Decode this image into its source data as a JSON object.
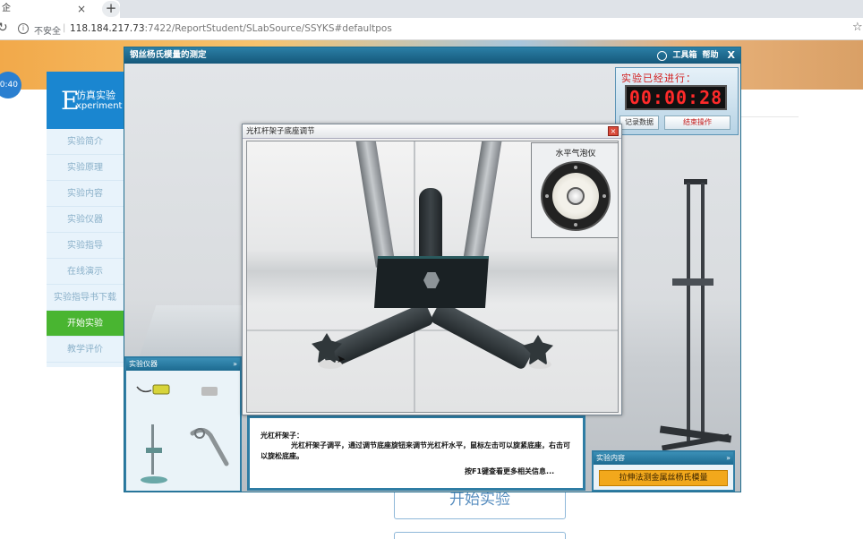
{
  "browser": {
    "tab_title": "企",
    "tab_close": "×",
    "new_tab": "+",
    "reload_icon": "↻",
    "info_icon": "i",
    "security_text": "不安全",
    "separator": "|",
    "url_host": "118.184.217.73",
    "url_rest": ":7422/ReportStudent/SLabSource/SSYKS#defaultpos",
    "bookmark_icon": "☆"
  },
  "page": {
    "clock_badge": "0:40",
    "logo_letter": "E",
    "logo_cn": "仿真实验",
    "logo_en": "xperiment",
    "start_button": "开始实验"
  },
  "sidebar": {
    "items": [
      {
        "label": "实验简介"
      },
      {
        "label": "实验原理"
      },
      {
        "label": "实验内容"
      },
      {
        "label": "实验仪器"
      },
      {
        "label": "实验指导"
      },
      {
        "label": "在线演示"
      },
      {
        "label": "实验指导书下载"
      },
      {
        "label": "开始实验"
      },
      {
        "label": "教学评价"
      }
    ],
    "active_index": 7
  },
  "sim": {
    "title": "钢丝杨氏模量的测定",
    "toolbox_label": "工具箱",
    "help_label": "帮助",
    "close_label": "X",
    "timer": {
      "label": "实验已经进行：",
      "value": "00:00:28",
      "record_button": "记录数据",
      "end_button": "结束操作"
    },
    "equipment_panel": {
      "title": "实验仪器",
      "collapse_icon": "»"
    },
    "content_panel": {
      "title": "实验内容",
      "collapse_icon": "»",
      "item": "拉伸法测金属丝杨氏模量"
    },
    "info": {
      "heading": "光杠杆架子：",
      "body": "光杠杆架子调平，通过调节底座旋钮来调节光杠杆水平，鼠标左击可以旋紧底座，右击可以旋松底座。",
      "hint": "按F1键查看更多相关信息..."
    }
  },
  "dialog": {
    "title": "光杠杆架子底座调节",
    "close_icon": "×",
    "bubble_label": "水平气泡仪"
  },
  "colors": {
    "accent_blue": "#1a86d0",
    "active_green": "#49b531",
    "timer_red": "#ff2a2a",
    "content_orange": "#f2a81c"
  }
}
